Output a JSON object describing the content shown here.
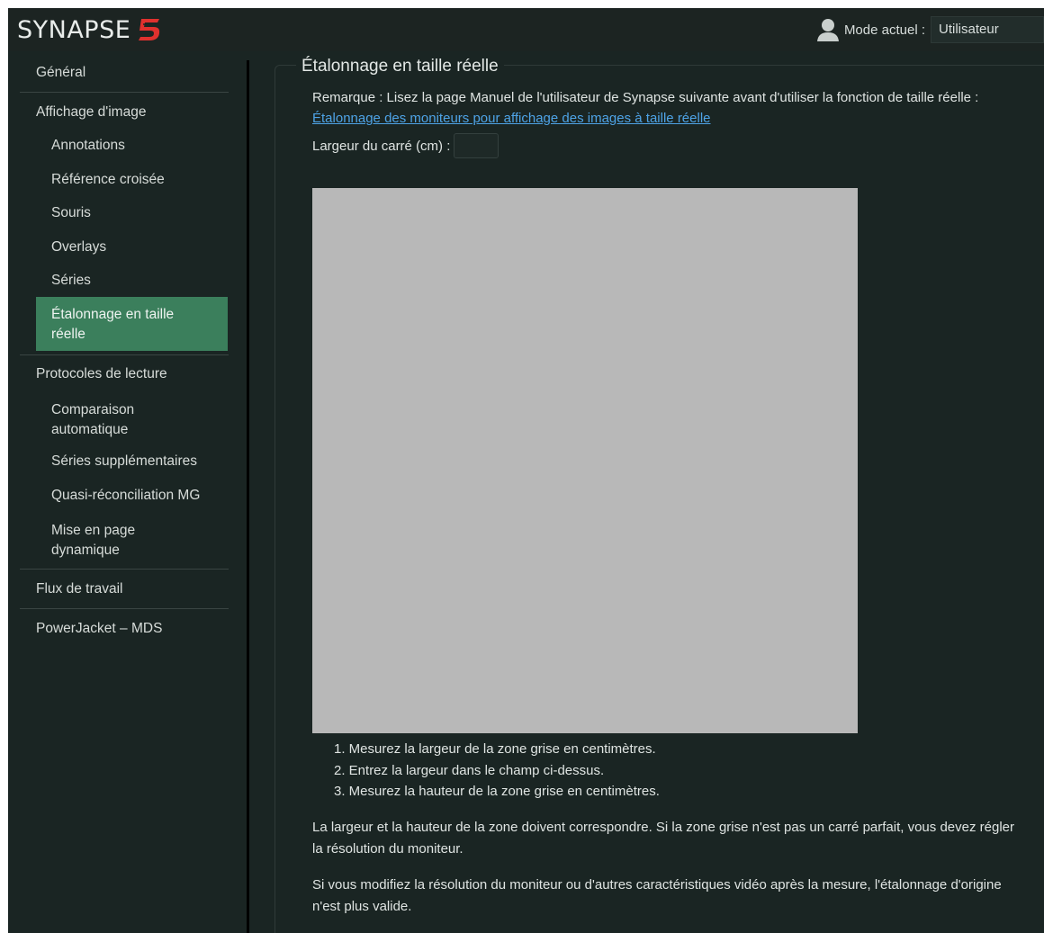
{
  "header": {
    "logo_text": "SYNAPSE",
    "logo_mark": "5",
    "mode_label": "Mode actuel :",
    "mode_value": "Utilisateur",
    "user_icon": "user-icon",
    "accent_color": "#e0312e"
  },
  "sidebar": {
    "active_color": "#3b7f5c",
    "items": [
      {
        "label": "Général",
        "level": "top"
      },
      {
        "label": "Affichage d'image",
        "level": "top"
      },
      {
        "label": "Annotations",
        "level": "sub"
      },
      {
        "label": "Référence croisée",
        "level": "sub"
      },
      {
        "label": "Souris",
        "level": "sub"
      },
      {
        "label": "Overlays",
        "level": "sub"
      },
      {
        "label": "Séries",
        "level": "sub"
      },
      {
        "label": "Étalonnage en taille réelle",
        "level": "sub",
        "active": true
      },
      {
        "label": "Protocoles de lecture",
        "level": "top"
      },
      {
        "label": "Comparaison automatique",
        "level": "sub"
      },
      {
        "label": "Séries supplémentaires",
        "level": "sub"
      },
      {
        "label": "Quasi-réconciliation MG",
        "level": "sub"
      },
      {
        "label": "Mise en page dynamique",
        "level": "sub"
      },
      {
        "label": "Flux de travail",
        "level": "top"
      },
      {
        "label": "PowerJacket – MDS",
        "level": "top"
      }
    ]
  },
  "main": {
    "title": "Étalonnage en taille réelle",
    "remark_prefix": "Remarque : Lisez la page Manuel de l'utilisateur de Synapse suivante avant d'utiliser la fonction de taille réelle :",
    "remark_link": "Étalonnage des moniteurs pour affichage des images à taille réelle",
    "width_label": "Largeur du carré (cm) :",
    "width_value": "",
    "square_color": "#b8b8b8",
    "steps": [
      "1. Mesurez la largeur de la zone grise en centimètres.",
      "2. Entrez la largeur dans le champ ci-dessus.",
      "3. Mesurez la hauteur de la zone grise en centimètres."
    ],
    "para1": "La largeur et la hauteur de la zone doivent correspondre. Si la zone grise n'est pas un carré parfait, vous devez régler la résolution du moniteur.",
    "para2": "Si vous modifiez la résolution du moniteur ou d'autres caractéristiques vidéo après la mesure, l'étalonnage d'origine n'est plus valide."
  }
}
